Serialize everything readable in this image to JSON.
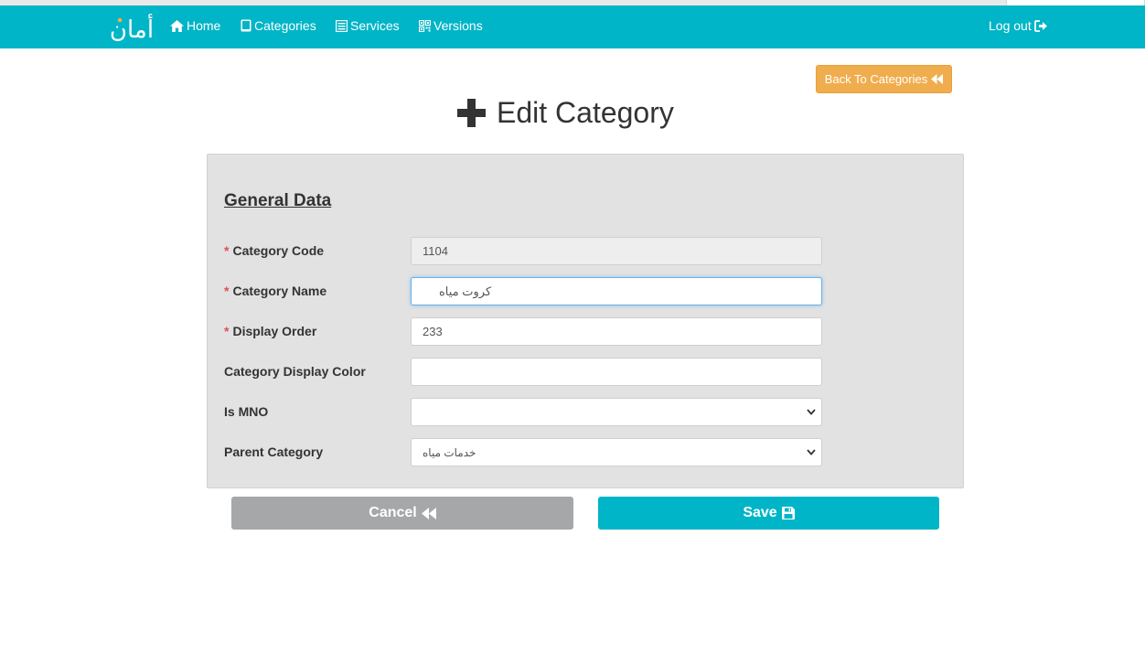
{
  "navbar": {
    "logo_text": "أمان",
    "items": [
      {
        "label": "Home",
        "icon": "home-icon"
      },
      {
        "label": "Categories",
        "icon": "tablet-icon"
      },
      {
        "label": "Services",
        "icon": "list-icon"
      },
      {
        "label": "Versions",
        "icon": "qrcode-icon"
      }
    ],
    "logout_label": "Log out",
    "logout_icon": "logout-icon"
  },
  "header": {
    "back_button_label": "Back To Categories",
    "title": "Edit Category",
    "title_icon": "plus-icon"
  },
  "form": {
    "section_title": "General Data",
    "fields": [
      {
        "label": "Category Code",
        "required": "*",
        "value": "1104",
        "type": "text",
        "state": "disabled"
      },
      {
        "label": "Category Name",
        "required": "*",
        "value": "كروت مياه",
        "type": "text",
        "state": "focused"
      },
      {
        "label": "Display Order",
        "required": "*",
        "value": "233",
        "type": "text",
        "state": "normal"
      },
      {
        "label": "Category Display Color",
        "required": "",
        "value": "",
        "type": "text",
        "state": "normal"
      },
      {
        "label": "Is MNO",
        "required": "",
        "value": "",
        "type": "select",
        "state": "normal"
      },
      {
        "label": "Parent Category",
        "required": "",
        "value": "خدمات مياه",
        "type": "select",
        "state": "normal"
      }
    ]
  },
  "actions": {
    "cancel_label": "Cancel",
    "save_label": "Save"
  },
  "colors": {
    "primary": "#00b5c7",
    "warning": "#f0ad4e",
    "cancel": "#a6a7a9",
    "panel": "#e2e2e2",
    "required": "#d9534f"
  }
}
